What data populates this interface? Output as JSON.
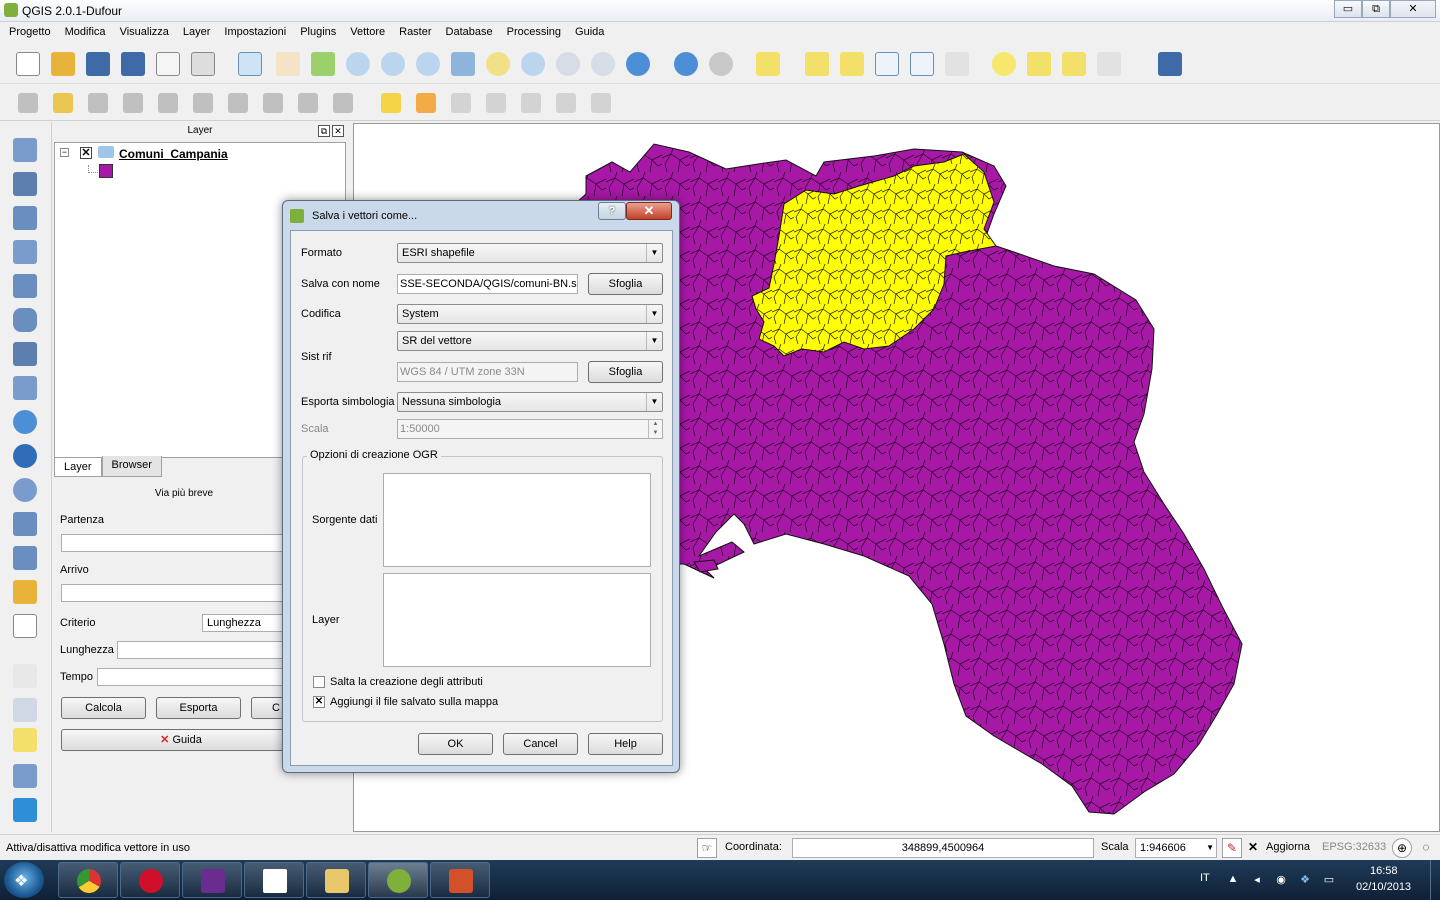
{
  "window": {
    "title": "QGIS 2.0.1-Dufour",
    "minimize": "▭",
    "maximize": "⧉",
    "close": "✕"
  },
  "menu": [
    "Progetto",
    "Modifica",
    "Visualizza",
    "Layer",
    "Impostazioni",
    "Plugins",
    "Vettore",
    "Raster",
    "Database",
    "Processing",
    "Guida"
  ],
  "layer_panel": {
    "title": "Layer",
    "float_glyph": "⧉",
    "close_glyph": "✕",
    "expander": "−",
    "check": "✕",
    "layer_name": "Comuni_Campania",
    "tabs": [
      "Layer",
      "Browser"
    ]
  },
  "route_panel": {
    "title": "Via più breve",
    "partenza": "Partenza",
    "arrivo": "Arrivo",
    "criterio": "Criterio",
    "criterio_value": "Lunghezza",
    "lunghezza": "Lunghezza",
    "tempo": "Tempo",
    "calcola": "Calcola",
    "esporta": "Esporta",
    "third_btn": "C",
    "guida": "Guida"
  },
  "dialog": {
    "title": "Salva i vettori come...",
    "help": "?",
    "close": "✕",
    "formato_label": "Formato",
    "formato_value": "ESRI shapefile",
    "salva_label": "Salva con nome",
    "salva_value": "SSE-SECONDA/QGIS/comuni-BN.shp",
    "sfoglia": "Sfoglia",
    "codifica_label": "Codifica",
    "codifica_value": "System",
    "sistrif_label": "Sist rif",
    "sistrif_value": "SR del vettore",
    "crs_value": "WGS 84 / UTM zone 33N",
    "simbologia_label": "Esporta simbologia",
    "simbologia_value": "Nessuna simbologia",
    "scala_label": "Scala",
    "scala_value": "1:50000",
    "ogr_group": "Opzioni di creazione OGR",
    "sorgente_label": "Sorgente dati",
    "layer_label": "Layer",
    "skip_attrs": "Salta la creazione degli attributi",
    "skip_attrs_checked": false,
    "add_to_map": "Aggiungi il file salvato sulla mappa",
    "add_to_map_checked": true,
    "check_glyph": "✕",
    "ok": "OK",
    "cancel": "Cancel",
    "help_btn": "Help",
    "arrow": "▼",
    "spin_up": "▲",
    "spin_down": "▼"
  },
  "status": {
    "message": "Attiva/disattiva modifica vettore in uso",
    "coord_label": "Coordinata:",
    "coord_value": "348899,4500964",
    "scala_label": "Scala",
    "scala_value": "1:946606",
    "aggiorna": "Aggiorna",
    "epsg": "EPSG:32633"
  },
  "taskbar": {
    "lang": "IT",
    "time": "16:58",
    "date": "02/10/2013"
  },
  "colors": {
    "campania": "#a718a7",
    "benevento": "#ffff00"
  }
}
